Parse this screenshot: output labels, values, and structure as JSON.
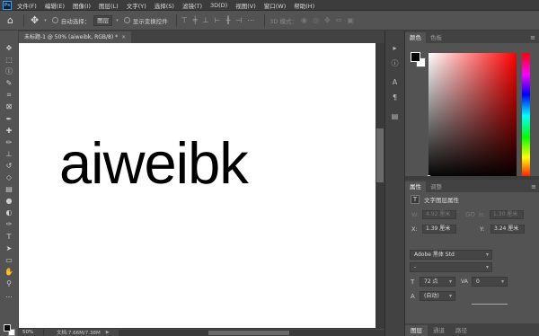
{
  "app": {
    "logo": "Ps"
  },
  "menu": [
    "文件(F)",
    "编辑(E)",
    "图像(I)",
    "图层(L)",
    "文字(Y)",
    "选择(S)",
    "滤镜(T)",
    "3D(D)",
    "视图(V)",
    "窗口(W)",
    "帮助(H)"
  ],
  "options": {
    "auto_select_label": "自动选择：",
    "auto_select_value": "图层",
    "show_transform_label": "显示变换控件",
    "mode_3d_label": "3D 模式："
  },
  "document": {
    "tab_title": "未标题-1 @ 50% (aiweibk, RGB/8) *",
    "close": "×",
    "canvas_text": "aiweibk",
    "zoom": "50%",
    "doc_info": "文档:7.66M/7.38M",
    "status_arrow": "▶"
  },
  "tools": [
    "move-icon",
    "marquee-icon",
    "lasso-icon",
    "quick-select-icon",
    "crop-icon",
    "frame-icon",
    "eyedropper-icon",
    "healing-brush-icon",
    "brush-icon",
    "clone-stamp-icon",
    "history-brush-icon",
    "eraser-icon",
    "gradient-icon",
    "blur-icon",
    "dodge-icon",
    "pen-icon",
    "type-icon",
    "path-select-icon",
    "rectangle-icon",
    "hand-icon",
    "zoom-icon",
    "more-tools-icon"
  ],
  "tool_glyphs": [
    "✥",
    "⬚",
    "ⓛ",
    "✎",
    "⌗",
    "⊠",
    "✒",
    "✚",
    "✏",
    "⊥",
    "↺",
    "◇",
    "▤",
    "●",
    "◐",
    "✑",
    "T",
    "➤",
    "▭",
    "✋",
    "⚲",
    "…"
  ],
  "color_panel": {
    "tabs": [
      "颜色",
      "色板"
    ],
    "foreground": "#000000",
    "background": "#ffffff"
  },
  "properties": {
    "tabs": [
      "属性",
      "调整"
    ],
    "title": "文字图层属性",
    "w_label": "W:",
    "w_value": "4.92 厘米",
    "h_label": "H:",
    "h_value": "1.30 厘米",
    "go_label": "GO",
    "x_label": "X:",
    "x_value": "1.39 厘米",
    "y_label": "Y:",
    "y_value": "3.24 厘米",
    "font_family": "Adobe 黑体 Std",
    "font_style": "-",
    "font_size": "72 点",
    "kerning_label": "VA",
    "kerning_value": "0",
    "leading": "(自动)",
    "type_icon": "T",
    "size_icon": "T",
    "leading_icon": "A"
  },
  "bottom_tabs": [
    "图层",
    "通道",
    "路径"
  ],
  "collapse_icons": [
    "history-icon",
    "info-icon",
    "character-icon",
    "paragraph-icon",
    "libraries-icon"
  ],
  "collapse_glyphs": [
    "▸",
    "ⓘ",
    "A",
    "¶",
    "▤"
  ]
}
